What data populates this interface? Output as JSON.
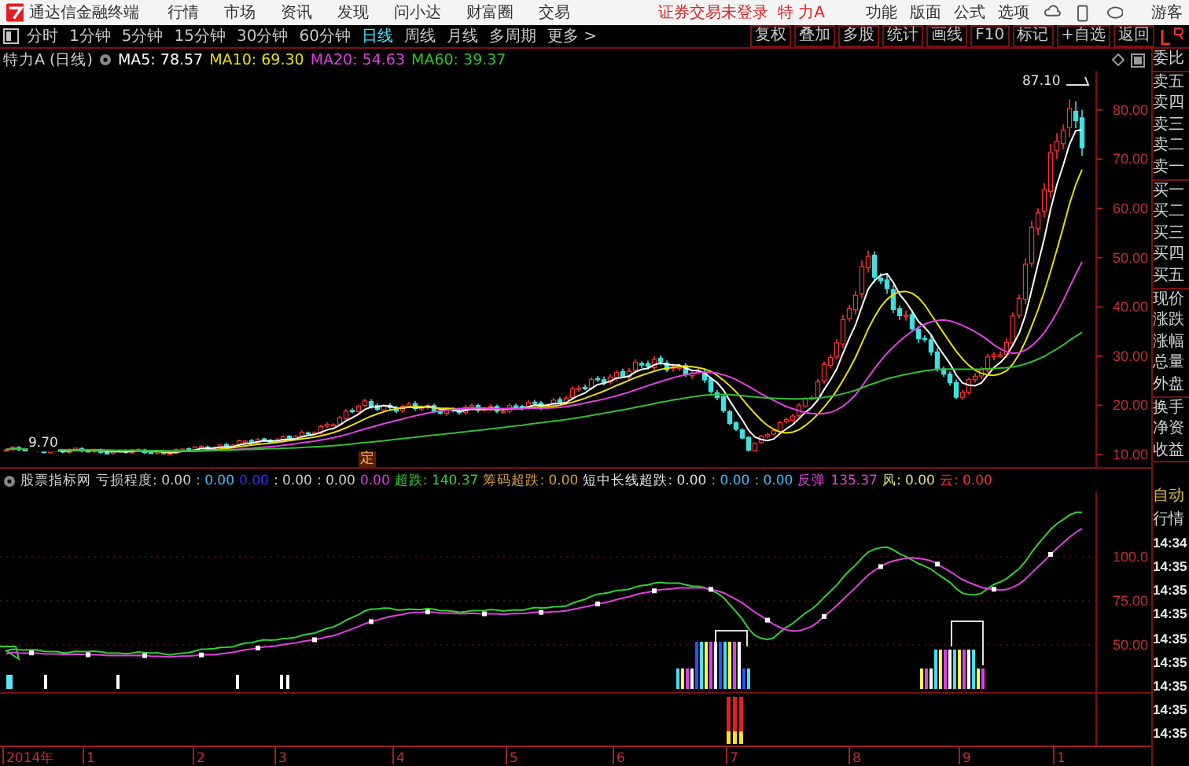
{
  "menu_bar": {
    "app_title": "通达信金融终端",
    "items": [
      "行情",
      "市场",
      "资讯",
      "发现",
      "问小达",
      "财富圈",
      "交易"
    ],
    "login_status": "证券交易未登录",
    "stock_name": "特 力A",
    "right_items": [
      "功能",
      "版面",
      "公式",
      "选项"
    ],
    "user": "游客"
  },
  "toolbar": {
    "periods": [
      {
        "label": "分时",
        "selected": false
      },
      {
        "label": "1分钟",
        "selected": false
      },
      {
        "label": "5分钟",
        "selected": false
      },
      {
        "label": "15分钟",
        "selected": false
      },
      {
        "label": "30分钟",
        "selected": false
      },
      {
        "label": "60分钟",
        "selected": false
      },
      {
        "label": "日线",
        "selected": true
      },
      {
        "label": "周线",
        "selected": false
      },
      {
        "label": "月线",
        "selected": false
      },
      {
        "label": "多周期",
        "selected": false
      },
      {
        "label": "更多 >",
        "selected": false
      }
    ],
    "actions": [
      "复权",
      "叠加",
      "多股",
      "统计",
      "画线",
      "F10",
      "标记",
      "+自选",
      "返回"
    ]
  },
  "info_line": {
    "title": "特力A (日线)",
    "moving_averages": [
      {
        "label": "MA5: 78.57",
        "color": "#ffffff"
      },
      {
        "label": "MA10: 69.30",
        "color": "#e8e000"
      },
      {
        "label": "MA20: 54.63",
        "color": "#e040e0"
      },
      {
        "label": "MA60: 39.37",
        "color": "#30c030"
      }
    ]
  },
  "main_chart": {
    "price_axis": [
      "80.00",
      "70.00",
      "60.00",
      "50.00",
      "40.00",
      "30.00",
      "20.00",
      "10.00"
    ],
    "high_label": "87.10",
    "low_label": "9.70",
    "marker": "定"
  },
  "indicator": {
    "name": "股票指标网",
    "segments": [
      {
        "text": "亏损程度: 0.00",
        "color": "#d0d0d0"
      },
      {
        "text": ": 0.00",
        "color": "#40c0ff"
      },
      {
        "text": "0.00",
        "color": "#3030ff"
      },
      {
        "text": ": 0.00",
        "color": "#d0d0d0"
      },
      {
        "text": ": 0.00",
        "color": "#d0d0d0"
      },
      {
        "text": "0.00",
        "color": "#e040e0"
      },
      {
        "text": "超跌: 140.37",
        "color": "#30d030"
      },
      {
        "text": "筹码超跌: 0.00",
        "color": "#d8a040"
      },
      {
        "text": "短中长线超跌: 0.00",
        "color": "#e0e0e0"
      },
      {
        "text": ": 0.00",
        "color": "#40c0ff"
      },
      {
        "text": ": 0.00",
        "color": "#40c0ff"
      },
      {
        "text": "反弹",
        "color": "#e040e0"
      },
      {
        "text": "135.37",
        "color": "#e040e0"
      },
      {
        "text": "风: 0.00",
        "color": "#e0e080"
      },
      {
        "text": "云: 0.00",
        "color": "#ff3030"
      }
    ],
    "axis": [
      "100.0",
      "75.00",
      "50.00"
    ]
  },
  "date_axis": [
    "2014年",
    "1",
    "2",
    "3",
    "4",
    "5",
    "6",
    "7",
    "8",
    "9",
    "1"
  ],
  "right_panel": {
    "groups": [
      [
        "委比"
      ],
      [
        "卖五",
        "卖四",
        "卖三",
        "卖二",
        "卖一"
      ],
      [
        "买一",
        "买二",
        "买三",
        "买四",
        "买五"
      ],
      [
        "现价",
        "涨跌",
        "涨幅",
        "总量",
        "外盘"
      ],
      [
        "换手",
        "净资",
        "收益"
      ]
    ],
    "auto_label": "自动",
    "quote_label": "行情",
    "times": [
      "14:34",
      "14:35",
      "14:35",
      "14:35",
      "14:35",
      "14:35",
      "14:35",
      "14:35",
      "14:35"
    ]
  }
}
